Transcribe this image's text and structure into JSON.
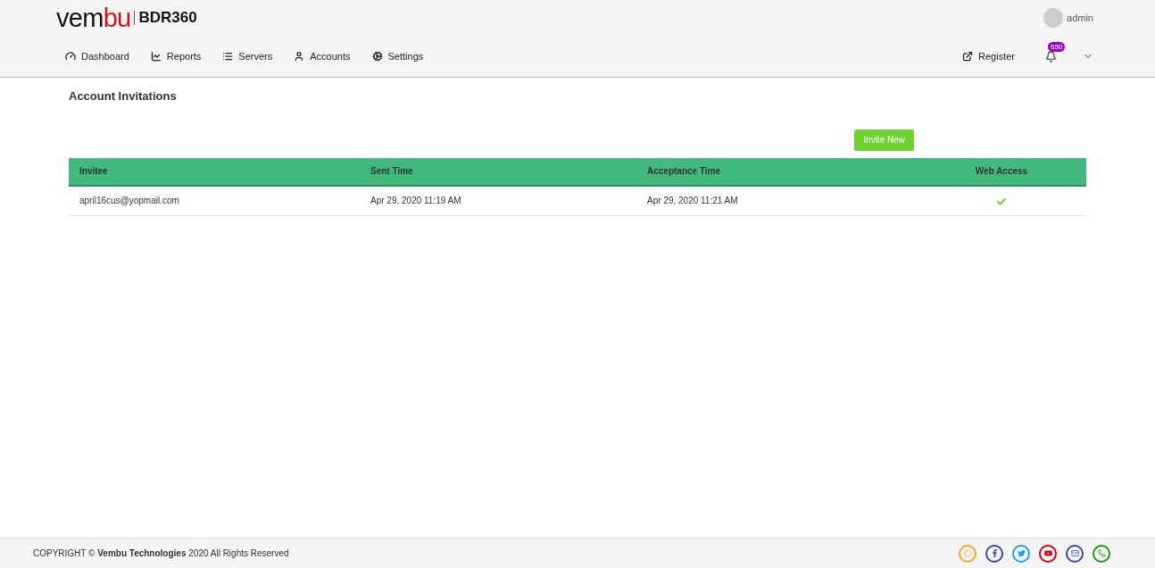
{
  "logo": {
    "parts": [
      {
        "text": "vem",
        "color": "#111111"
      },
      {
        "text": "bu",
        "color": "#d0121b"
      }
    ],
    "product": "BDR360"
  },
  "user": {
    "name": "admin"
  },
  "nav": [
    {
      "kind": "dashboard",
      "label": "Dashboard"
    },
    {
      "kind": "reports",
      "label": "Reports"
    },
    {
      "kind": "servers",
      "label": "Servers"
    },
    {
      "kind": "accounts",
      "label": "Accounts"
    },
    {
      "kind": "settings",
      "label": "Settings"
    }
  ],
  "register": {
    "label": "Register"
  },
  "notifications": {
    "count": "650"
  },
  "page": {
    "title": "Account Invitations",
    "invite_button": "Invite New"
  },
  "table": {
    "columns": [
      "Invitee",
      "Sent Time",
      "Acceptance Time",
      "Web Access"
    ],
    "rows": [
      {
        "invitee": "april16cus@yopmail.com",
        "sent": "Apr 29, 2020 11:19 AM",
        "accepted": "Apr 29, 2020 11:21 AM",
        "web_access": true
      }
    ]
  },
  "footer": {
    "prefix": "COPYRIGHT ©",
    "company": "Vembu Technologies",
    "suffix": "2020 All Rights Reserved",
    "social": [
      {
        "kind": "chat",
        "color": "#f5a623"
      },
      {
        "kind": "facebook",
        "color": "#3b4a9c"
      },
      {
        "kind": "twitter",
        "color": "#1da1f2"
      },
      {
        "kind": "youtube",
        "color": "#d0021b"
      },
      {
        "kind": "mail",
        "color": "#3b4a9c"
      },
      {
        "kind": "phone",
        "color": "#1a9a1a"
      }
    ]
  }
}
